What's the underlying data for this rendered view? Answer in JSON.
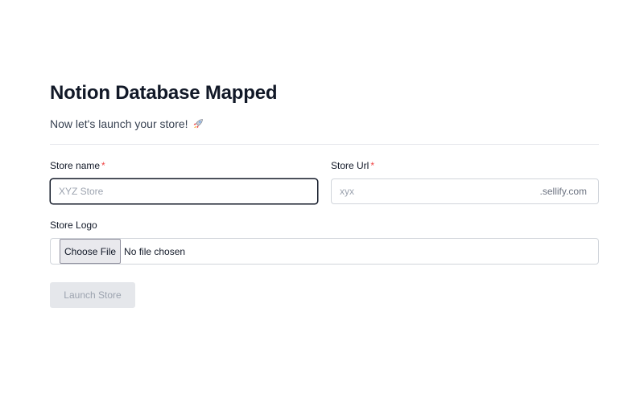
{
  "header": {
    "title": "Notion Database Mapped",
    "subtitle": "Now let's launch your store!",
    "subtitle_icon": "rocket-icon"
  },
  "form": {
    "store_name": {
      "label": "Store name",
      "required_mark": "*",
      "placeholder": "XYZ Store",
      "value": ""
    },
    "store_url": {
      "label": "Store Url",
      "required_mark": "*",
      "placeholder": "xyx",
      "suffix": ".sellify.com",
      "value": ""
    },
    "store_logo": {
      "label": "Store Logo",
      "button_label": "Choose File",
      "status": "No file chosen"
    },
    "submit": {
      "label": "Launch Store",
      "disabled": true
    }
  },
  "colors": {
    "required": "#ef4444",
    "placeholder": "#9ca3af",
    "disabled_button_bg": "#e5e7eb",
    "focused_border": "#111827"
  }
}
